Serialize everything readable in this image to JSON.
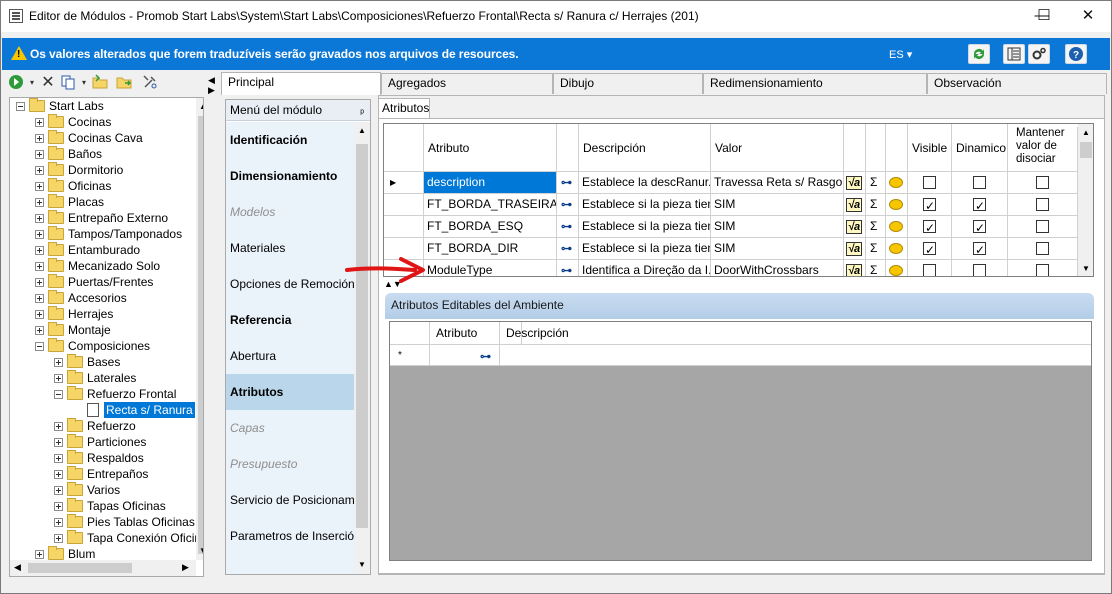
{
  "window": {
    "title": "Editor de Módulos - Promob Start Labs\\System\\Start Labs\\Composiciones\\Refuerzo Frontal\\Recta s/ Ranura c/ Herrajes (201)",
    "minimize": "—",
    "maximize": "☐",
    "close": "✕"
  },
  "infobar": {
    "message": "Os valores alterados que forem traduzíveis serão gravados nos arquivos de resources.",
    "language": "ES ▾"
  },
  "tree": {
    "items": [
      {
        "label": "Start Labs",
        "level": 0,
        "state": "open"
      },
      {
        "label": "Cocinas",
        "level": 1,
        "state": "closed"
      },
      {
        "label": "Cocinas Cava",
        "level": 1,
        "state": "closed"
      },
      {
        "label": "Baños",
        "level": 1,
        "state": "closed"
      },
      {
        "label": "Dormitorio",
        "level": 1,
        "state": "closed"
      },
      {
        "label": "Oficinas",
        "level": 1,
        "state": "closed"
      },
      {
        "label": "Placas",
        "level": 1,
        "state": "closed"
      },
      {
        "label": "Entrepaño Externo",
        "level": 1,
        "state": "closed"
      },
      {
        "label": "Tampos/Tamponados",
        "level": 1,
        "state": "closed"
      },
      {
        "label": "Entamburado",
        "level": 1,
        "state": "closed"
      },
      {
        "label": "Mecanizado Solo",
        "level": 1,
        "state": "closed"
      },
      {
        "label": "Puertas/Frentes",
        "level": 1,
        "state": "closed"
      },
      {
        "label": "Accesorios",
        "level": 1,
        "state": "closed"
      },
      {
        "label": "Herrajes",
        "level": 1,
        "state": "closed"
      },
      {
        "label": "Montaje",
        "level": 1,
        "state": "closed"
      },
      {
        "label": "Composiciones",
        "level": 1,
        "state": "open"
      },
      {
        "label": "Bases",
        "level": 2,
        "state": "closed"
      },
      {
        "label": "Laterales",
        "level": 2,
        "state": "closed"
      },
      {
        "label": "Refuerzo Frontal",
        "level": 2,
        "state": "open"
      },
      {
        "label": "Recta s/ Ranura",
        "level": 3,
        "state": "leaf",
        "selected": true
      },
      {
        "label": "Refuerzo",
        "level": 2,
        "state": "closed"
      },
      {
        "label": "Particiones",
        "level": 2,
        "state": "closed"
      },
      {
        "label": "Respaldos",
        "level": 2,
        "state": "closed"
      },
      {
        "label": "Entrepaños",
        "level": 2,
        "state": "closed"
      },
      {
        "label": "Varios",
        "level": 2,
        "state": "closed"
      },
      {
        "label": "Tapas Oficinas",
        "level": 2,
        "state": "closed"
      },
      {
        "label": "Pies Tablas Oficinas",
        "level": 2,
        "state": "closed"
      },
      {
        "label": "Tapa Conexión Oficinas",
        "level": 2,
        "state": "closed"
      },
      {
        "label": "Blum",
        "level": 1,
        "state": "closed"
      }
    ]
  },
  "tabs": {
    "principal": "Principal",
    "agregados": "Agregados",
    "dibujo": "Dibujo",
    "redimensionamiento": "Redimensionamiento",
    "observacion": "Observación"
  },
  "menu": {
    "header": "Menú del módulo",
    "pin": "📌",
    "items": [
      {
        "label": "Identificación",
        "style": "bold"
      },
      {
        "label": "Dimensionamiento",
        "style": "bold"
      },
      {
        "label": "Modelos",
        "style": "disabled"
      },
      {
        "label": "Materiales",
        "style": "normal"
      },
      {
        "label": "Opciones de Remoción",
        "style": "normal"
      },
      {
        "label": "Referencia",
        "style": "bold"
      },
      {
        "label": "Abertura",
        "style": "normal"
      },
      {
        "label": "Atributos",
        "style": "bold-selected"
      },
      {
        "label": "Capas",
        "style": "disabled"
      },
      {
        "label": "Presupuesto",
        "style": "disabled"
      },
      {
        "label": "Servicio de Posicionamiento",
        "style": "normal"
      },
      {
        "label": "Parametros de Inserción",
        "style": "normal"
      }
    ]
  },
  "subtab": "Atributos",
  "grid": {
    "headers": {
      "attribute": "Atributo",
      "description": "Descripción",
      "value": "Valor",
      "visible": "Visible",
      "dynamic": "Dinamico",
      "keep": "Mantener valor de disociar"
    },
    "rows": [
      {
        "attribute": "description",
        "description": "Establece la descRanur...",
        "value": "Travessa Reta s/ Rasgo",
        "visible": false,
        "dynamic": false,
        "keep": false,
        "current": true
      },
      {
        "attribute": "FT_BORDA_TRASEIRA",
        "description": "Establece si la pieza tien...",
        "value": "SIM",
        "visible": true,
        "dynamic": true,
        "keep": false
      },
      {
        "attribute": "FT_BORDA_ESQ",
        "description": "Establece si la pieza tien...",
        "value": "SIM",
        "visible": true,
        "dynamic": true,
        "keep": false
      },
      {
        "attribute": "FT_BORDA_DIR",
        "description": "Establece si la pieza tien...",
        "value": "SIM",
        "visible": true,
        "dynamic": true,
        "keep": false
      },
      {
        "attribute": "ModuleType",
        "description": "Identifica a Direção da I...",
        "value": "DoorWithCrossbars",
        "visible": false,
        "dynamic": false,
        "keep": false
      }
    ]
  },
  "env": {
    "title": "Atributos Editables del Ambiente",
    "col_attribute": "Atributo",
    "col_description": "Descripción",
    "new_row_marker": "*"
  },
  "colors": {
    "accent": "#0b78d7",
    "selection": "#0078d7",
    "menu_selected": "#b9d6ea",
    "arrow": "#e01515"
  }
}
